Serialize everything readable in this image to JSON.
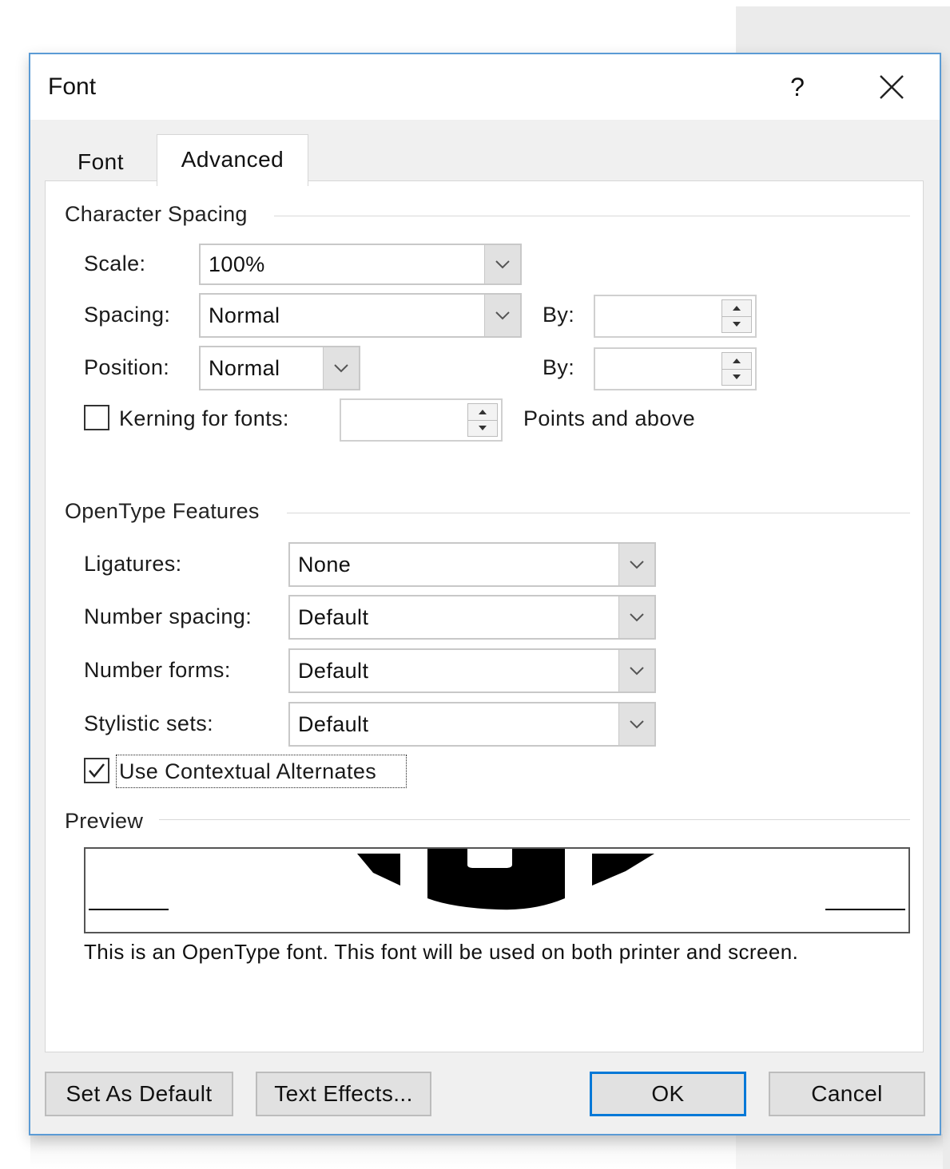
{
  "dialog": {
    "title": "Font",
    "help_glyph": "?",
    "close_icon": "close-icon"
  },
  "tabs": [
    {
      "label": "Font",
      "selected": false
    },
    {
      "label": "Advanced",
      "selected": true
    }
  ],
  "character_spacing": {
    "group_title": "Character Spacing",
    "scale": {
      "label": "Scale:",
      "value": "100%"
    },
    "spacing": {
      "label": "Spacing:",
      "value": "Normal",
      "by_label": "By:",
      "by_value": ""
    },
    "position": {
      "label": "Position:",
      "value": "Normal",
      "by_label": "By:",
      "by_value": ""
    },
    "kerning": {
      "label": "Kerning for fonts:",
      "checked": false,
      "value": "",
      "suffix": "Points and above"
    }
  },
  "opentype": {
    "group_title": "OpenType Features",
    "ligatures": {
      "label": "Ligatures:",
      "value": "None"
    },
    "number_spacing": {
      "label": "Number spacing:",
      "value": "Default"
    },
    "number_forms": {
      "label": "Number forms:",
      "value": "Default"
    },
    "stylistic_sets": {
      "label": "Stylistic sets:",
      "value": "Default"
    },
    "contextual_alternates": {
      "label": "Use Contextual Alternates",
      "checked": true
    }
  },
  "preview": {
    "group_title": "Preview",
    "note": "This is an OpenType font. This font will be used on both printer and screen."
  },
  "buttons": {
    "set_default": "Set As Default",
    "text_effects": "Text Effects...",
    "ok": "OK",
    "cancel": "Cancel"
  },
  "colors": {
    "accent": "#0078d7",
    "dialog_border": "#5b9bd5",
    "background": "#f0f0f0"
  }
}
